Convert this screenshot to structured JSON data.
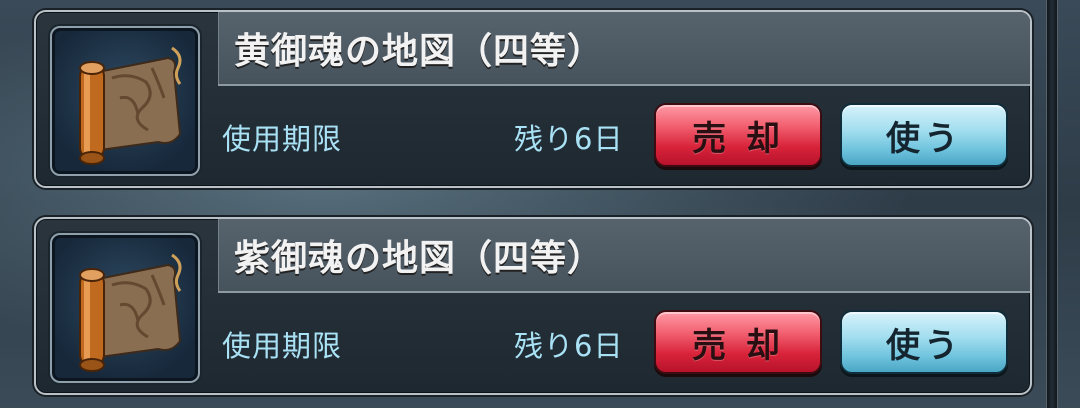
{
  "items": [
    {
      "name": "黄御魂の地図（四等）",
      "expiry_label": "使用期限",
      "remaining": "残り6日",
      "sell_label": "売 却",
      "use_label": "使う",
      "icon": "treasure-map-scroll-icon"
    },
    {
      "name": "紫御魂の地図（四等）",
      "expiry_label": "使用期限",
      "remaining": "残り6日",
      "sell_label": "売 却",
      "use_label": "使う",
      "icon": "treasure-map-scroll-icon"
    }
  ],
  "colors": {
    "sell_button": "#e03a4f",
    "use_button": "#8fd3ea",
    "label_text": "#a9e1f5",
    "title_text": "#f2f2f2"
  }
}
